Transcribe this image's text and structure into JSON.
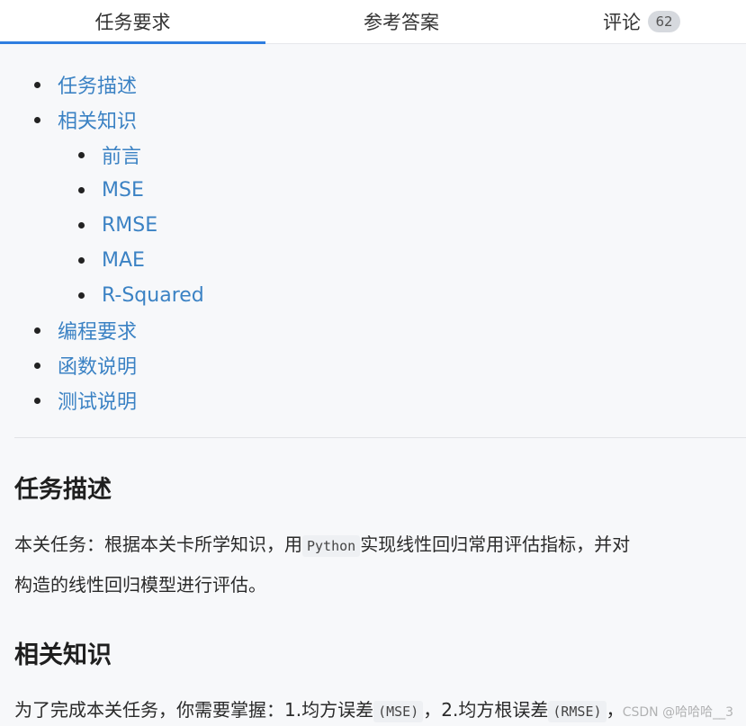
{
  "tabs": [
    {
      "label": "任务要求",
      "active": true
    },
    {
      "label": "参考答案",
      "active": false
    },
    {
      "label": "评论",
      "active": false,
      "badge": "62"
    }
  ],
  "toc": [
    {
      "label": "任务描述",
      "level": 1
    },
    {
      "label": "相关知识",
      "level": 1
    },
    {
      "label": "前言",
      "level": 2
    },
    {
      "label": "MSE",
      "level": 2
    },
    {
      "label": "RMSE",
      "level": 2
    },
    {
      "label": "MAE",
      "level": 2
    },
    {
      "label": "R-Squared",
      "level": 2
    },
    {
      "label": "编程要求",
      "level": 1
    },
    {
      "label": "函数说明",
      "level": 1
    },
    {
      "label": "测试说明",
      "level": 1
    }
  ],
  "sections": {
    "task": {
      "title": "任务描述",
      "p1_before": "本关任务：根据本关卡所学知识，用",
      "p1_code": "Python",
      "p1_after": "实现线性回归常用评估指标，并对",
      "p2": "构造的线性回归模型进行评估。"
    },
    "knowledge": {
      "title": "相关知识",
      "p1_a": "为了完成本关任务，你需要掌握：1.均方误差",
      "p1_code1": "(MSE)",
      "p1_b": "，2.均方根误差",
      "p1_code2": "(RMSE)",
      "p1_c": "，"
    }
  },
  "watermark": "CSDN @哈哈哈__3"
}
